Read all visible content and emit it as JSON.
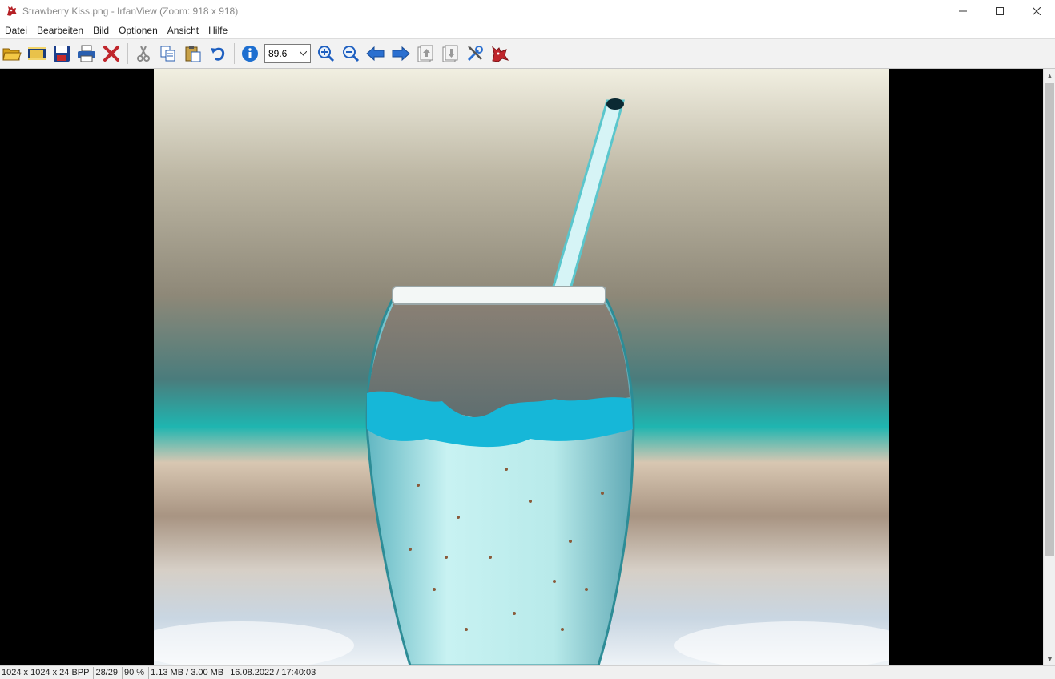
{
  "window": {
    "title": "Strawberry Kiss.png - IrfanView (Zoom: 918 x 918)",
    "minimize": "—",
    "maximize": "☐",
    "close": "✕"
  },
  "menu": [
    "Datei",
    "Bearbeiten",
    "Bild",
    "Optionen",
    "Ansicht",
    "Hilfe"
  ],
  "toolbar": {
    "zoom_value": "89.6",
    "buttons": [
      "open-folder-icon",
      "slideshow-icon",
      "save-icon",
      "print-icon",
      "delete-icon",
      "cut-icon",
      "copy-icon",
      "paste-icon",
      "undo-icon",
      "info-icon",
      "zoom-in-icon",
      "zoom-out-icon",
      "previous-arrow-icon",
      "next-arrow-icon",
      "first-page-icon",
      "last-page-icon",
      "settings-tools-icon",
      "irfanview-cat-icon"
    ]
  },
  "status": {
    "dimensions": "1024 x 1024 x 24 BPP",
    "index": "28/29",
    "zoom": "90 %",
    "size": "1.13 MB / 3.00 MB",
    "date": "16.08.2022 / 17:40:03"
  },
  "colors": {
    "toolbar_bg": "#f2f2f2",
    "viewer_bg": "#000000",
    "accent_blue": "#1e6fd0",
    "delete_red": "#c0262c"
  }
}
